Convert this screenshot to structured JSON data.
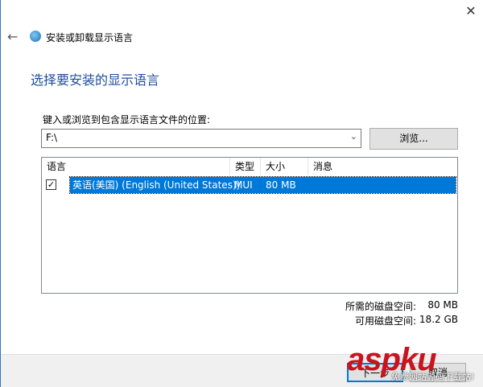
{
  "window": {
    "title": "安装或卸载显示语言",
    "close_glyph": "✕",
    "back_glyph": "←"
  },
  "heading": "选择要安装的显示语言",
  "path": {
    "label": "键入或浏览到包含显示语言文件的位置:",
    "value": "F:\\",
    "browse": "浏览..."
  },
  "list": {
    "columns": [
      "语言",
      "类型",
      "大小",
      "消息"
    ],
    "rows": [
      {
        "checked": true,
        "language": "英语(美国) (English (United States))",
        "type": "MUI",
        "size": "80 MB",
        "message": ""
      }
    ]
  },
  "disk": {
    "required_label": "所需的磁盘空间:",
    "required_value": "80 MB",
    "available_label": "可用磁盘空间:",
    "available_value": "18.2 GB"
  },
  "footer": {
    "next": "下一步",
    "cancel": "取消"
  },
  "watermark": {
    "logo": "aspku.com",
    "tagline": "免费网站源码下载站!"
  },
  "colors": {
    "accent": "#0078d7",
    "heading": "#1e4e9c"
  }
}
